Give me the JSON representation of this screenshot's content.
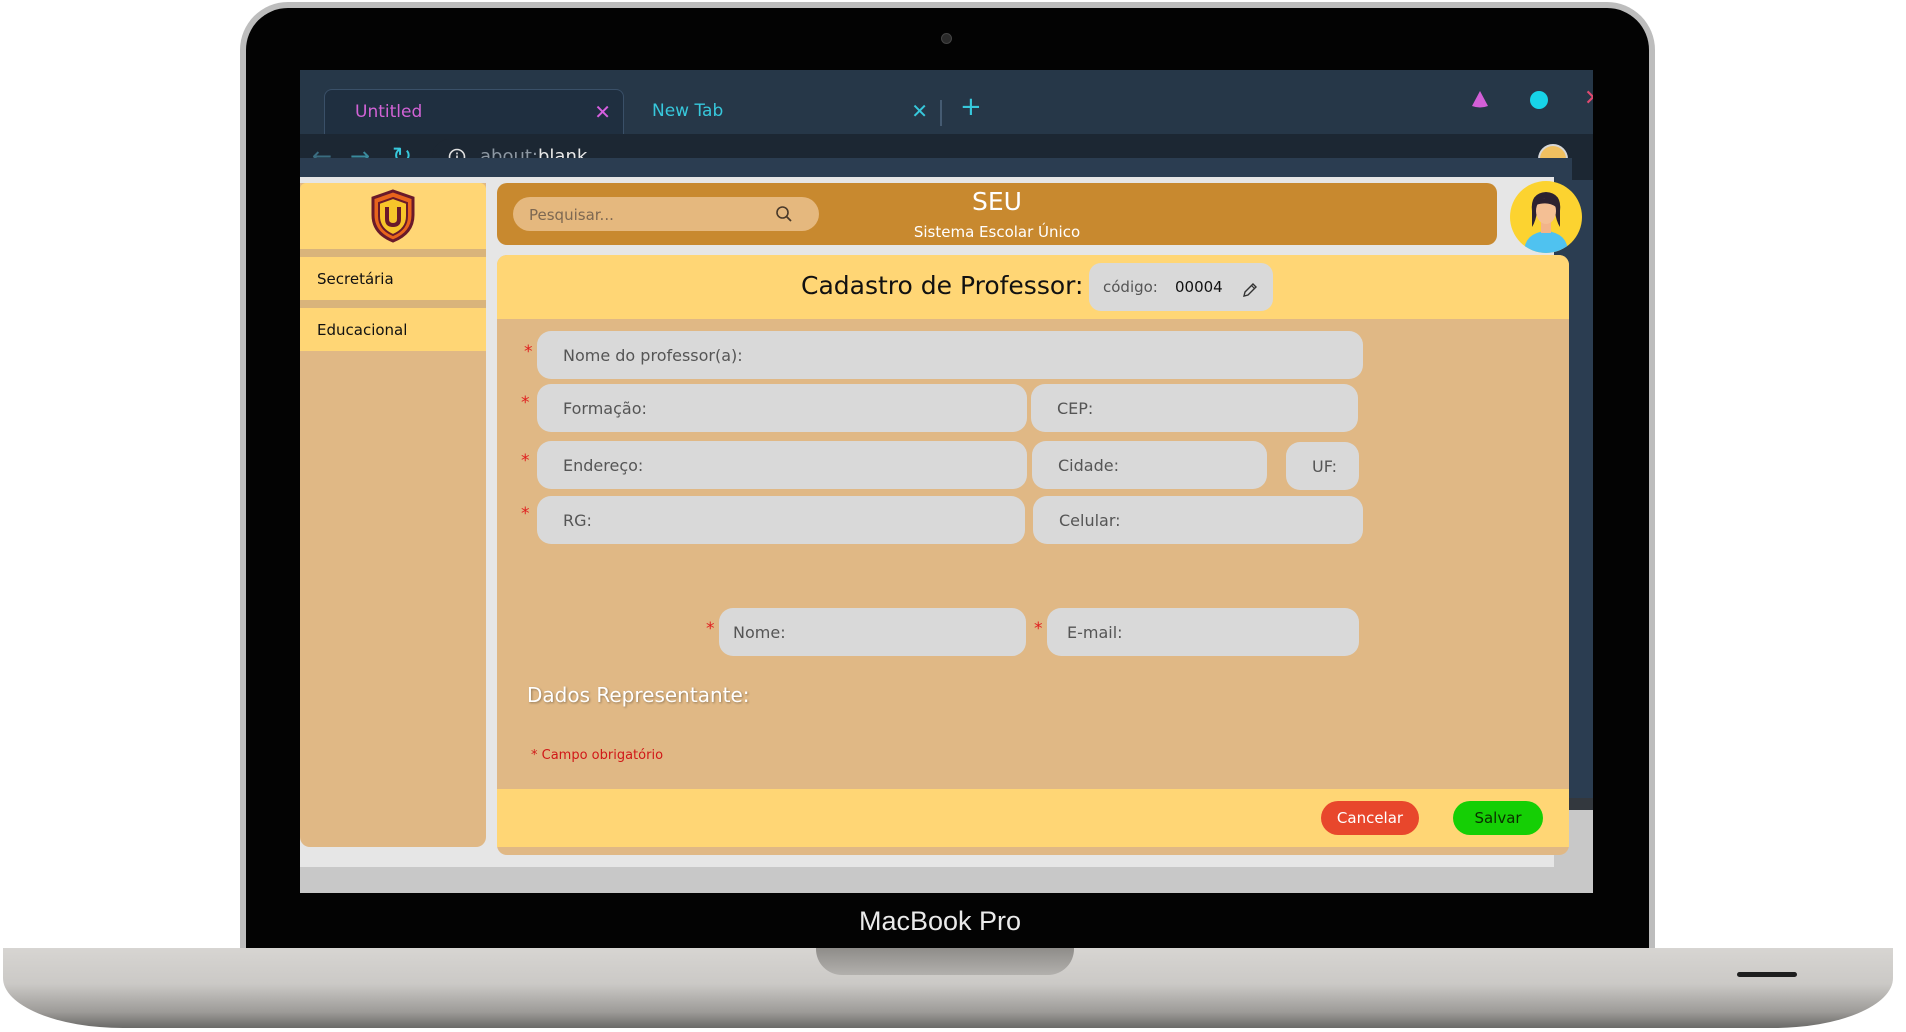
{
  "device": {
    "label": "MacBook Pro"
  },
  "browser": {
    "tabs": [
      {
        "title": "Untitled",
        "active": true
      },
      {
        "title": "New Tab",
        "active": false
      }
    ],
    "url_prefix": "about:",
    "url_main": "blank",
    "icons": [
      "back-arrow",
      "forward-arrow",
      "reload",
      "info",
      "star",
      "profile",
      "triangle-extension",
      "circle-extension"
    ],
    "colors": {
      "tab_active_text": "#d263d6",
      "tab_text": "#37c8dc",
      "toolbar": "#263748"
    }
  },
  "app": {
    "title": "SEU",
    "subtitle": "Sistema Escolar Único",
    "search": {
      "placeholder": "Pesquisar..."
    },
    "sidebar": {
      "items": [
        {
          "label": "Secretária"
        },
        {
          "label": "Educacional"
        }
      ]
    },
    "form": {
      "title": "Cadastro de Professor:",
      "code_label": "código:",
      "code_value": "00004",
      "fields": {
        "nome_professor": "Nome do professor(a):",
        "formacao": "Formação:",
        "cep": "CEP:",
        "endereco": "Endereço:",
        "cidade": "Cidade:",
        "uf": "UF:",
        "rg": "RG:",
        "celular": "Celular:",
        "rep_nome": "Nome:",
        "rep_email": "E-mail:"
      },
      "required_marker": "*",
      "representative_label": "Dados Representante:",
      "required_note": "* Campo obrigatório",
      "buttons": {
        "cancel": "Cancelar",
        "save": "Salvar"
      }
    },
    "colors": {
      "header_bar": "#c8892f",
      "panel": "#e0b885",
      "highlight": "#ffd675",
      "cancel": "#e8472c",
      "save": "#15cf05",
      "required": "#e02020"
    }
  }
}
